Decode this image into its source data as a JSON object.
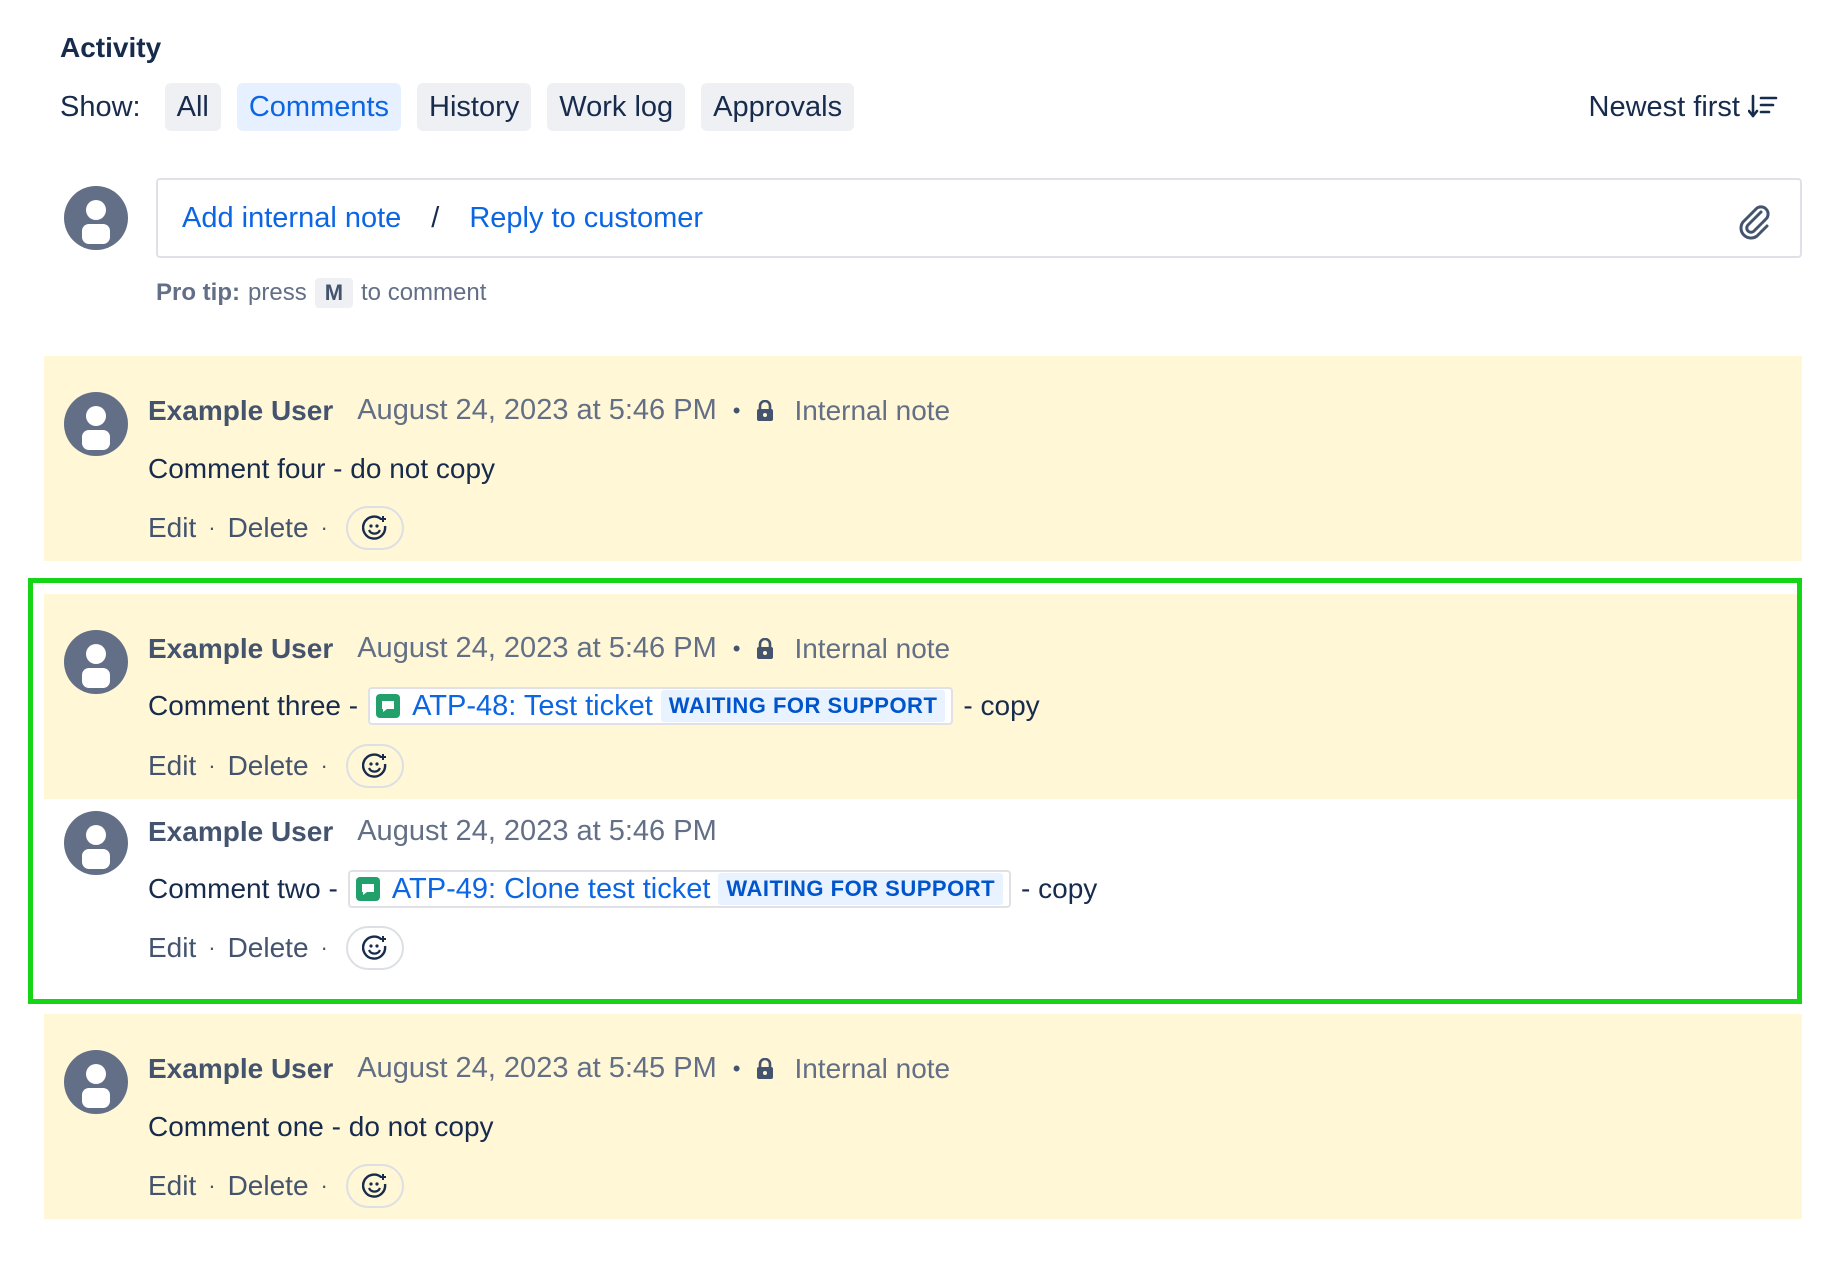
{
  "activity": {
    "title": "Activity",
    "show_label": "Show:",
    "filters": [
      {
        "label": "All",
        "active": false
      },
      {
        "label": "Comments",
        "active": true
      },
      {
        "label": "History",
        "active": false
      },
      {
        "label": "Work log",
        "active": false
      },
      {
        "label": "Approvals",
        "active": false
      }
    ],
    "sort_label": "Newest first"
  },
  "composer": {
    "add_internal_note": "Add internal note",
    "separator": "/",
    "reply_to_customer": "Reply to customer",
    "protip_bold": "Pro tip:",
    "protip_press": "press",
    "protip_key": "M",
    "protip_suffix": "to comment"
  },
  "comments": [
    {
      "author": "Example User",
      "date": "August 24, 2023 at 5:46 PM",
      "dot": "•",
      "type": "Internal note",
      "text": "Comment four - do not copy",
      "edit": "Edit",
      "delete": "Delete",
      "action_sep": "·"
    },
    {
      "author": "Example User",
      "date": "August 24, 2023 at 5:46 PM",
      "dot": "•",
      "type": "Internal note",
      "text_before": "Comment three -",
      "issue_key": "ATP-48: Test ticket",
      "issue_status": "WAITING FOR SUPPORT",
      "text_after": "- copy",
      "edit": "Edit",
      "delete": "Delete",
      "action_sep": "·"
    },
    {
      "author": "Example User",
      "date": "August 24, 2023 at 5:46 PM",
      "text_before": "Comment two -",
      "issue_key": "ATP-49: Clone test ticket",
      "issue_status": "WAITING FOR SUPPORT",
      "text_after": "- copy",
      "edit": "Edit",
      "delete": "Delete",
      "action_sep": "·"
    },
    {
      "author": "Example User",
      "date": "August 24, 2023 at 5:45 PM",
      "dot": "•",
      "type": "Internal note",
      "text": "Comment one - do not copy",
      "edit": "Edit",
      "delete": "Delete",
      "action_sep": "·"
    }
  ],
  "colors": {
    "internal_note_bg": "#fff7d6",
    "link": "#0c66e4",
    "highlight_border": "#16d416",
    "status_lozenge_bg": "#e9f2ff"
  }
}
